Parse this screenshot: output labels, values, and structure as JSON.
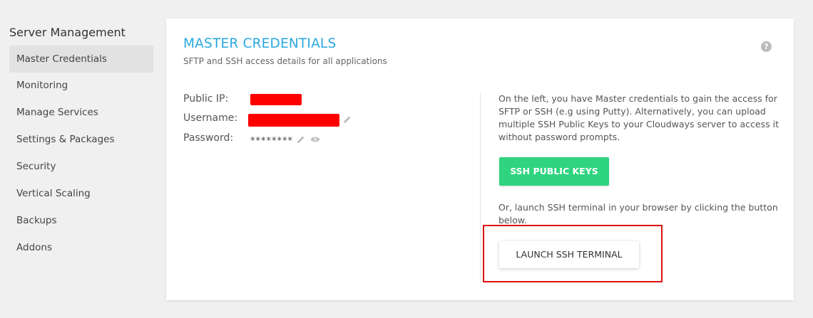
{
  "sidebar": {
    "title": "Server Management",
    "items": [
      {
        "label": "Master Credentials",
        "active": true
      },
      {
        "label": "Monitoring"
      },
      {
        "label": "Manage Services"
      },
      {
        "label": "Settings & Packages"
      },
      {
        "label": "Security"
      },
      {
        "label": "Vertical Scaling"
      },
      {
        "label": "Backups"
      },
      {
        "label": "Addons"
      }
    ]
  },
  "card": {
    "title": "MASTER CREDENTIALS",
    "subtitle": "SFTP and SSH access details for all applications",
    "help_icon": "?"
  },
  "credentials": {
    "public_ip_label": "Public IP:",
    "username_label": "Username:",
    "password_label": "Password:",
    "password_value": "********"
  },
  "info": {
    "text": "On the left, you have Master credentials to gain the access for SFTP or SSH (e.g using Putty). Alternatively, you can upload multiple SSH Public Keys to your Cloudways server to access it without password prompts.",
    "ssh_keys_button": "SSH PUBLIC KEYS",
    "launch_text": "Or, launch SSH terminal in your browser by clicking the button below.",
    "launch_button": "LAUNCH SSH TERMINAL"
  },
  "colors": {
    "accent": "#2aa8df",
    "green_button": "#2ed47f",
    "highlight": "#dd1111",
    "redaction": "#ff0000"
  }
}
